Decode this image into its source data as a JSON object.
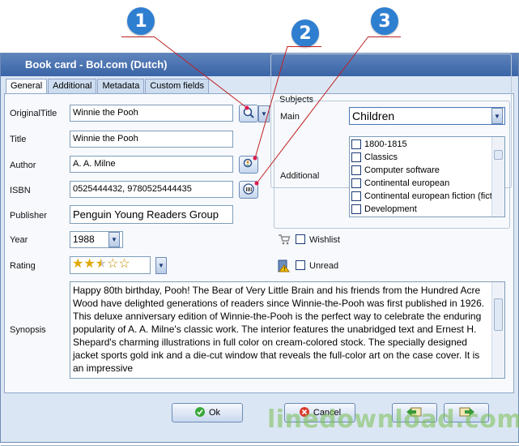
{
  "callouts": [
    "1",
    "2",
    "3"
  ],
  "window": {
    "title": "Book card - Bol.com (Dutch)"
  },
  "tabs": [
    "General",
    "Additional",
    "Metadata",
    "Custom fields"
  ],
  "form": {
    "original_title": {
      "label": "OriginalTitle",
      "value": "Winnie the Pooh"
    },
    "title": {
      "label": "Title",
      "value": "Winnie the Pooh"
    },
    "author": {
      "label": "Author",
      "value": "A. A. Milne"
    },
    "isbn": {
      "label": "ISBN",
      "value": "0525444432, 9780525444435"
    },
    "publisher": {
      "label": "Publisher",
      "value": "Penguin Young Readers Group"
    },
    "year": {
      "label": "Year",
      "value": "1988"
    },
    "rating": {
      "label": "Rating",
      "value": 2.5,
      "max": 5
    },
    "synopsis": {
      "label": "Synopsis",
      "value": "Happy 80th birthday, Pooh! The Bear of Very Little Brain and his friends from the Hundred Acre Wood have delighted generations of readers since Winnie-the-Pooh was first published in 1926. This deluxe anniversary edition of Winnie-the-Pooh is the perfect way to celebrate the enduring popularity of A. A. Milne's classic work. The interior features the unabridged text and Ernest H. Shepard's charming illustrations in full color on cream-colored stock. The specially designed jacket sports gold ink and a die-cut window that reveals the full-color art on the case cover. It is an impressive"
    }
  },
  "subjects": {
    "legend": "Subjects",
    "main_label": "Main",
    "main_value": "Children",
    "additional_label": "Additional",
    "items": [
      "1800-1815",
      "Classics",
      "Computer software",
      "Continental european",
      "Continental european fiction (fict",
      "Development"
    ]
  },
  "wishlist_label": "Wishlist",
  "unread_label": "Unread",
  "buttons": {
    "ok": "Ok",
    "cancel": "Cancel"
  },
  "watermark": "linedownload.com",
  "colors": {
    "accent": "#2f7fd1",
    "titlebar": "#3a64a6",
    "callout_line": "#c02020"
  },
  "icons": [
    "search-web-icon",
    "author-search-icon",
    "isbn-barcode-icon",
    "cart-icon",
    "warning-book-icon",
    "check-icon",
    "cancel-icon",
    "prev-arrow-icon",
    "next-arrow-icon"
  ]
}
